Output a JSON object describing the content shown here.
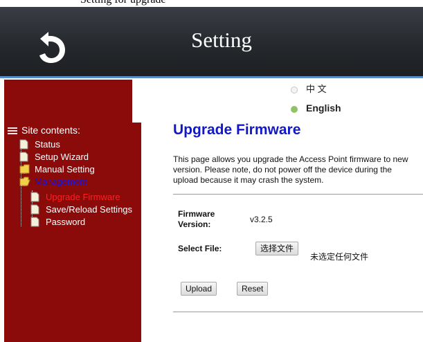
{
  "top_caption": "Setting for upgrade",
  "header": {
    "title": "Setting",
    "back_icon": "back-arrow-icon"
  },
  "languages": [
    {
      "label": "中 文",
      "selected": false
    },
    {
      "label": "English",
      "selected": true
    }
  ],
  "sidebar": {
    "root": "Site contents:",
    "items": [
      {
        "label": "Status",
        "type": "page"
      },
      {
        "label": "Setup Wizard",
        "type": "page"
      },
      {
        "label": "Manual Setting",
        "type": "folder"
      },
      {
        "label": "Management",
        "type": "folder-open",
        "active": true
      },
      {
        "label": "Upgrade Firmware",
        "type": "page",
        "active": true
      },
      {
        "label": "Save/Reload Settings",
        "type": "page"
      },
      {
        "label": "Password",
        "type": "page"
      }
    ]
  },
  "main": {
    "title": "Upgrade Firmware",
    "description": "This page allows you upgrade the Access Point firmware to new version. Please note, do not power off the device during the upload because it may crash the system.",
    "firmware_version_label": "Firmware Version:",
    "firmware_version_value": "v3.2.5",
    "select_file_label": "Select File:",
    "choose_file_button": "选择文件",
    "no_file_text": "未选定任何文件",
    "upload_button": "Upload",
    "reset_button": "Reset"
  },
  "colors": {
    "sidebar_bg": "#8b0b0b",
    "title_blue": "#1218c8",
    "header_bg": "#25282c"
  }
}
